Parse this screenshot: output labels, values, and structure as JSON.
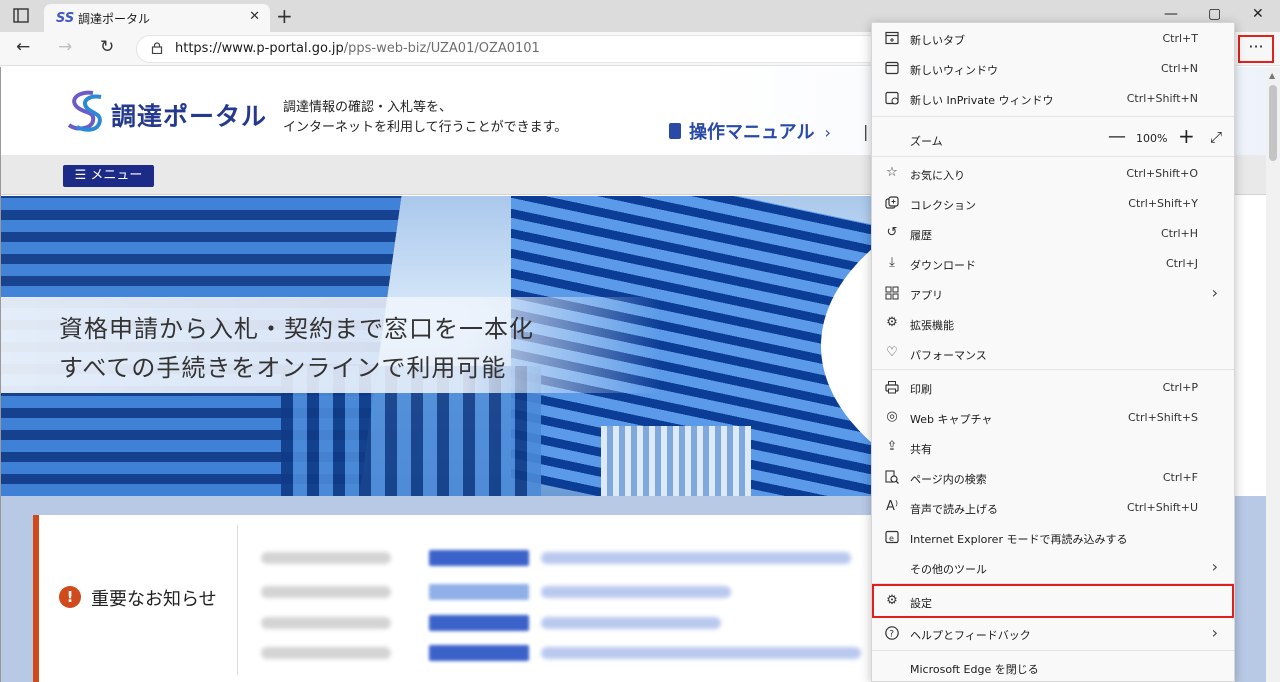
{
  "browser": {
    "tab": {
      "favicon": "SS",
      "title": "調達ポータル",
      "close_glyph": "✕"
    },
    "new_tab_glyph": "+",
    "window": {
      "minimize": "—",
      "maximize": "▢",
      "close": "✕"
    },
    "nav": {
      "back": "←",
      "forward": "→",
      "reload": "↻"
    },
    "address": {
      "host": "https://www.p-portal.go.jp",
      "path": "/pps-web-biz/UZA01/OZA0101"
    },
    "more_button": "···"
  },
  "site": {
    "logo": "調達ポータル",
    "tagline_line1": "調達情報の確認・入札等を、",
    "tagline_line2": "インターネットを利用して行うことができます。",
    "manual_link": "操作マニュアル",
    "manual_chevron": "›",
    "divider": "|",
    "menu_button": "☰ メニュー",
    "hero_line1": "資格申請から入札・契約まで窓口を一本化",
    "hero_line2": "すべての手続きをオンラインで利用可能",
    "notice_icon": "!",
    "notice_title": "重要なお知らせ"
  },
  "edge_menu": {
    "items": [
      {
        "label": "新しいタブ",
        "shortcut": "Ctrl+T",
        "icon": "new-tab-icon"
      },
      {
        "label": "新しいウィンドウ",
        "shortcut": "Ctrl+N",
        "icon": "new-window-icon"
      },
      {
        "label": "新しい InPrivate ウィンドウ",
        "shortcut": "Ctrl+Shift+N",
        "icon": "inprivate-icon"
      },
      {
        "label": "ズーム",
        "zoom_value": "100%",
        "icon": ""
      },
      {
        "label": "お気に入り",
        "shortcut": "Ctrl+Shift+O",
        "icon": "favorites-icon"
      },
      {
        "label": "コレクション",
        "shortcut": "Ctrl+Shift+Y",
        "icon": "collections-icon"
      },
      {
        "label": "履歴",
        "shortcut": "Ctrl+H",
        "icon": "history-icon"
      },
      {
        "label": "ダウンロード",
        "shortcut": "Ctrl+J",
        "icon": "download-icon"
      },
      {
        "label": "アプリ",
        "shortcut": "",
        "icon": "apps-icon"
      },
      {
        "label": "拡張機能",
        "shortcut": "",
        "icon": "extensions-icon"
      },
      {
        "label": "パフォーマンス",
        "shortcut": "",
        "icon": "performance-icon"
      },
      {
        "label": "印刷",
        "shortcut": "Ctrl+P",
        "icon": "print-icon"
      },
      {
        "label": "Web キャプチャ",
        "shortcut": "Ctrl+Shift+S",
        "icon": "web-capture-icon"
      },
      {
        "label": "共有",
        "shortcut": "",
        "icon": "share-icon"
      },
      {
        "label": "ページ内の検索",
        "shortcut": "Ctrl+F",
        "icon": "find-icon"
      },
      {
        "label": "音声で読み上げる",
        "shortcut": "Ctrl+Shift+U",
        "icon": "read-aloud-icon"
      },
      {
        "label": "Internet Explorer モードで再読み込みする",
        "shortcut": "",
        "icon": "ie-mode-icon"
      },
      {
        "label": "その他のツール",
        "shortcut": "",
        "icon": ""
      },
      {
        "label": "設定",
        "shortcut": "",
        "icon": "settings-icon"
      },
      {
        "label": "ヘルプとフィードバック",
        "shortcut": "",
        "icon": "help-icon"
      },
      {
        "label": "Microsoft Edge を閉じる",
        "shortcut": "",
        "icon": ""
      }
    ],
    "zoom_minus": "—",
    "zoom_plus": "+",
    "zoom_fullscreen": "⤢",
    "submenu_arrow": "›",
    "highlight_color": "#e0201c"
  },
  "colors": {
    "brand_navy": "#1c2a88",
    "notice_accent": "#d04a1c",
    "link_blue": "#2a4aa8"
  }
}
